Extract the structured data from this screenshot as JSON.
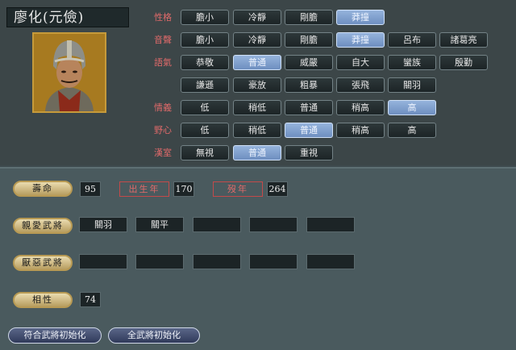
{
  "officer": {
    "name": "廖化(元儉)"
  },
  "rows": {
    "personality": {
      "label": "性格",
      "options": [
        "膽小",
        "冷靜",
        "剛膽",
        "莽撞"
      ],
      "selected": 3
    },
    "voice": {
      "label": "音聲",
      "options": [
        "膽小",
        "冷靜",
        "剛膽",
        "莽撞",
        "呂布",
        "諸葛亮"
      ],
      "selected": 3
    },
    "tone": {
      "label": "語氣",
      "options": [
        "恭敬",
        "普通",
        "威嚴",
        "自大",
        "蠻族",
        "殷勤",
        "謙遜",
        "豪放",
        "粗暴",
        "張飛",
        "關羽"
      ],
      "selected": 1
    },
    "loyalty": {
      "label": "情義",
      "options": [
        "低",
        "稍低",
        "普通",
        "稍高",
        "高"
      ],
      "selected": 4
    },
    "ambition": {
      "label": "野心",
      "options": [
        "低",
        "稍低",
        "普通",
        "稍高",
        "高"
      ],
      "selected": 2
    },
    "han": {
      "label": "漢室",
      "options": [
        "無視",
        "普通",
        "重視"
      ],
      "selected": 1
    }
  },
  "lifespan": {
    "label": "壽命",
    "value": "95",
    "birth_label": "出生年",
    "birth": "170",
    "death_label": "歿年",
    "death": "264"
  },
  "liked": {
    "label": "親愛武將",
    "slots": [
      "關羽",
      "關平",
      "",
      "",
      ""
    ]
  },
  "disliked": {
    "label": "厭惡武將",
    "slots": [
      "",
      "",
      "",
      "",
      ""
    ]
  },
  "compat": {
    "label": "相性",
    "value": "74"
  },
  "footer": {
    "reset_matching": "符合武將初始化",
    "reset_all": "全武將初始化"
  },
  "colors": {
    "selected": "#7f9fce",
    "accent_gold": "#c69a3a",
    "label_red": "#e06a6a"
  }
}
